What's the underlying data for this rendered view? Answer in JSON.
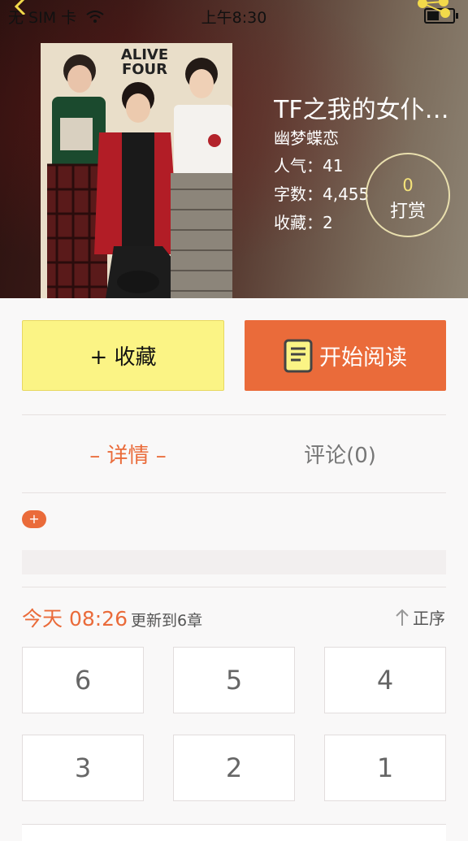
{
  "status_bar": {
    "carrier": "无 SIM 卡",
    "time": "上午8:30"
  },
  "book": {
    "title": "TF之我的女仆…",
    "author": "幽梦蝶恋",
    "popularity": "人气：41",
    "word_count": "字数：4,455",
    "favorites": "收藏：2",
    "cover_logo_line1": "ALIVE",
    "cover_logo_line2": "FOUR"
  },
  "reward": {
    "count": "0",
    "label": "打赏"
  },
  "actions": {
    "favorite_label": "+ 收藏",
    "read_label": "开始阅读"
  },
  "tabs": {
    "detail": "– 详情 –",
    "comments": "评论(0)"
  },
  "expand_label": "+",
  "update": {
    "time": "今天 08:26",
    "chapter": "更新到6章"
  },
  "sort_label": "正序",
  "chapters": [
    "6",
    "5",
    "4",
    "3",
    "2",
    "1"
  ],
  "colors": {
    "accent": "#ea6b3a",
    "favorite_bg": "#fbf485",
    "reward_count": "#f5e37a"
  }
}
